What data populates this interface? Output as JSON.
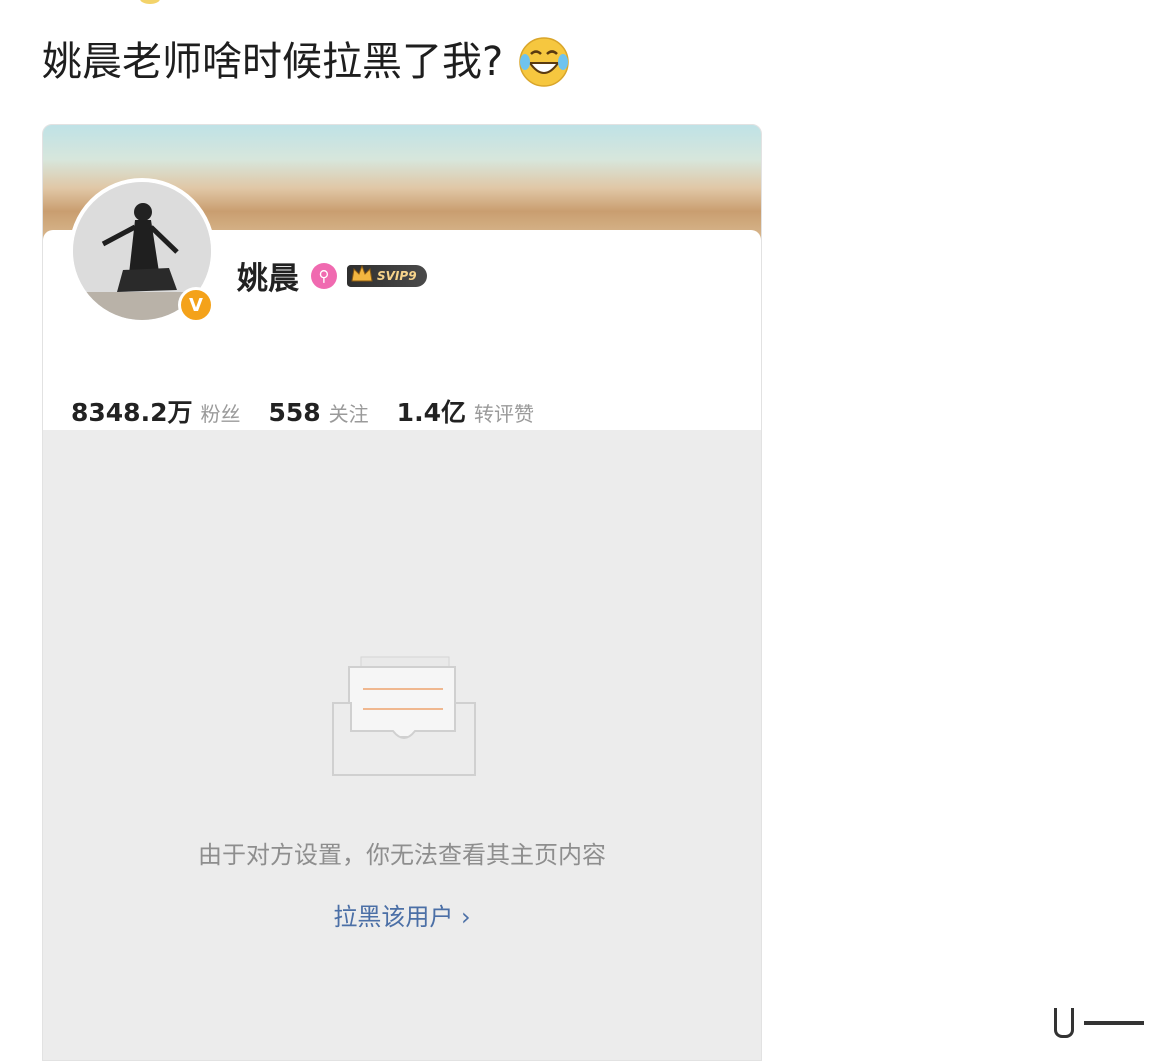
{
  "post": {
    "text": "姚晨老师啥时候拉黑了我?",
    "emoji": "laughing-tears-emoji"
  },
  "profile": {
    "name": "姚晨",
    "verified_badge": "V",
    "member_badge": "SVIP9",
    "stats": [
      {
        "value": "8348.2万",
        "label": "粉丝"
      },
      {
        "value": "558",
        "label": "关注"
      },
      {
        "value": "1.4亿",
        "label": "转评赞"
      }
    ]
  },
  "blocked": {
    "message": "由于对方设置，你无法查看其主页内容",
    "action": "拉黑该用户 ›"
  },
  "colors": {
    "link": "#4b6fa6",
    "verified": "#f4a21a",
    "accent_pink": "#f06ab0"
  }
}
